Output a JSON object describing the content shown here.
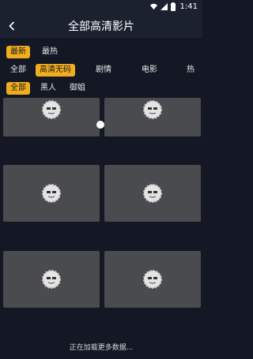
{
  "status_bar": {
    "time": "1:41"
  },
  "header": {
    "title": "全部高清影片"
  },
  "filters": {
    "sort": {
      "items": [
        "最新",
        "最热"
      ],
      "selected": 0
    },
    "category": {
      "items": [
        "全部",
        "高清无码",
        "剧情",
        "电影",
        "热"
      ],
      "selected": 1
    },
    "tags": {
      "items": [
        "全部",
        "黑人",
        "御姐"
      ],
      "selected": 0
    }
  },
  "videos": [
    {
      "title": ""
    },
    {
      "title": ""
    },
    {
      "title": ""
    },
    {
      "title": ""
    },
    {
      "title": ""
    },
    {
      "title": ""
    }
  ],
  "footer": {
    "loading_text": "正在加载更多数据..."
  },
  "colors": {
    "accent": "#f0ad1f",
    "background": "#131824",
    "tile": "#4a4b4f"
  }
}
